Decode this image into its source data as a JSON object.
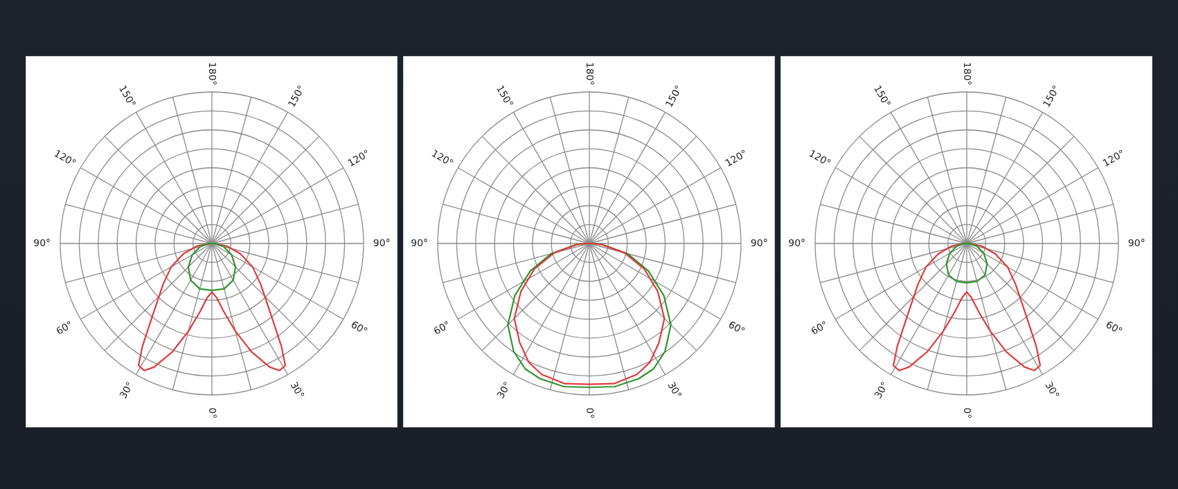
{
  "panels": [
    {
      "axis_labels": [
        "180°",
        "150°",
        "150°",
        "120°",
        "120°",
        "90°",
        "90°",
        "60°",
        "60°",
        "30°",
        "30°",
        "0°"
      ],
      "curves": [
        {
          "kind": "batwing",
          "color": "#e03a3a"
        },
        {
          "kind": "small-lobe",
          "color": "#2e952e"
        }
      ]
    },
    {
      "axis_labels": [
        "180°",
        "150°",
        "150°",
        "120°",
        "120°",
        "90°",
        "90°",
        "60°",
        "60°",
        "30°",
        "30°",
        "0°"
      ],
      "curves": [
        {
          "kind": "wide-lobe-outer",
          "color": "#2e952e"
        },
        {
          "kind": "wide-lobe",
          "color": "#e03a3a"
        }
      ]
    },
    {
      "axis_labels": [
        "180°",
        "150°",
        "150°",
        "120°",
        "120°",
        "90°",
        "90°",
        "60°",
        "60°",
        "30°",
        "30°",
        "0°"
      ],
      "curves": [
        {
          "kind": "batwing",
          "color": "#e03a3a"
        },
        {
          "kind": "small-lobe-narrow",
          "color": "#2e952e"
        }
      ]
    }
  ]
}
